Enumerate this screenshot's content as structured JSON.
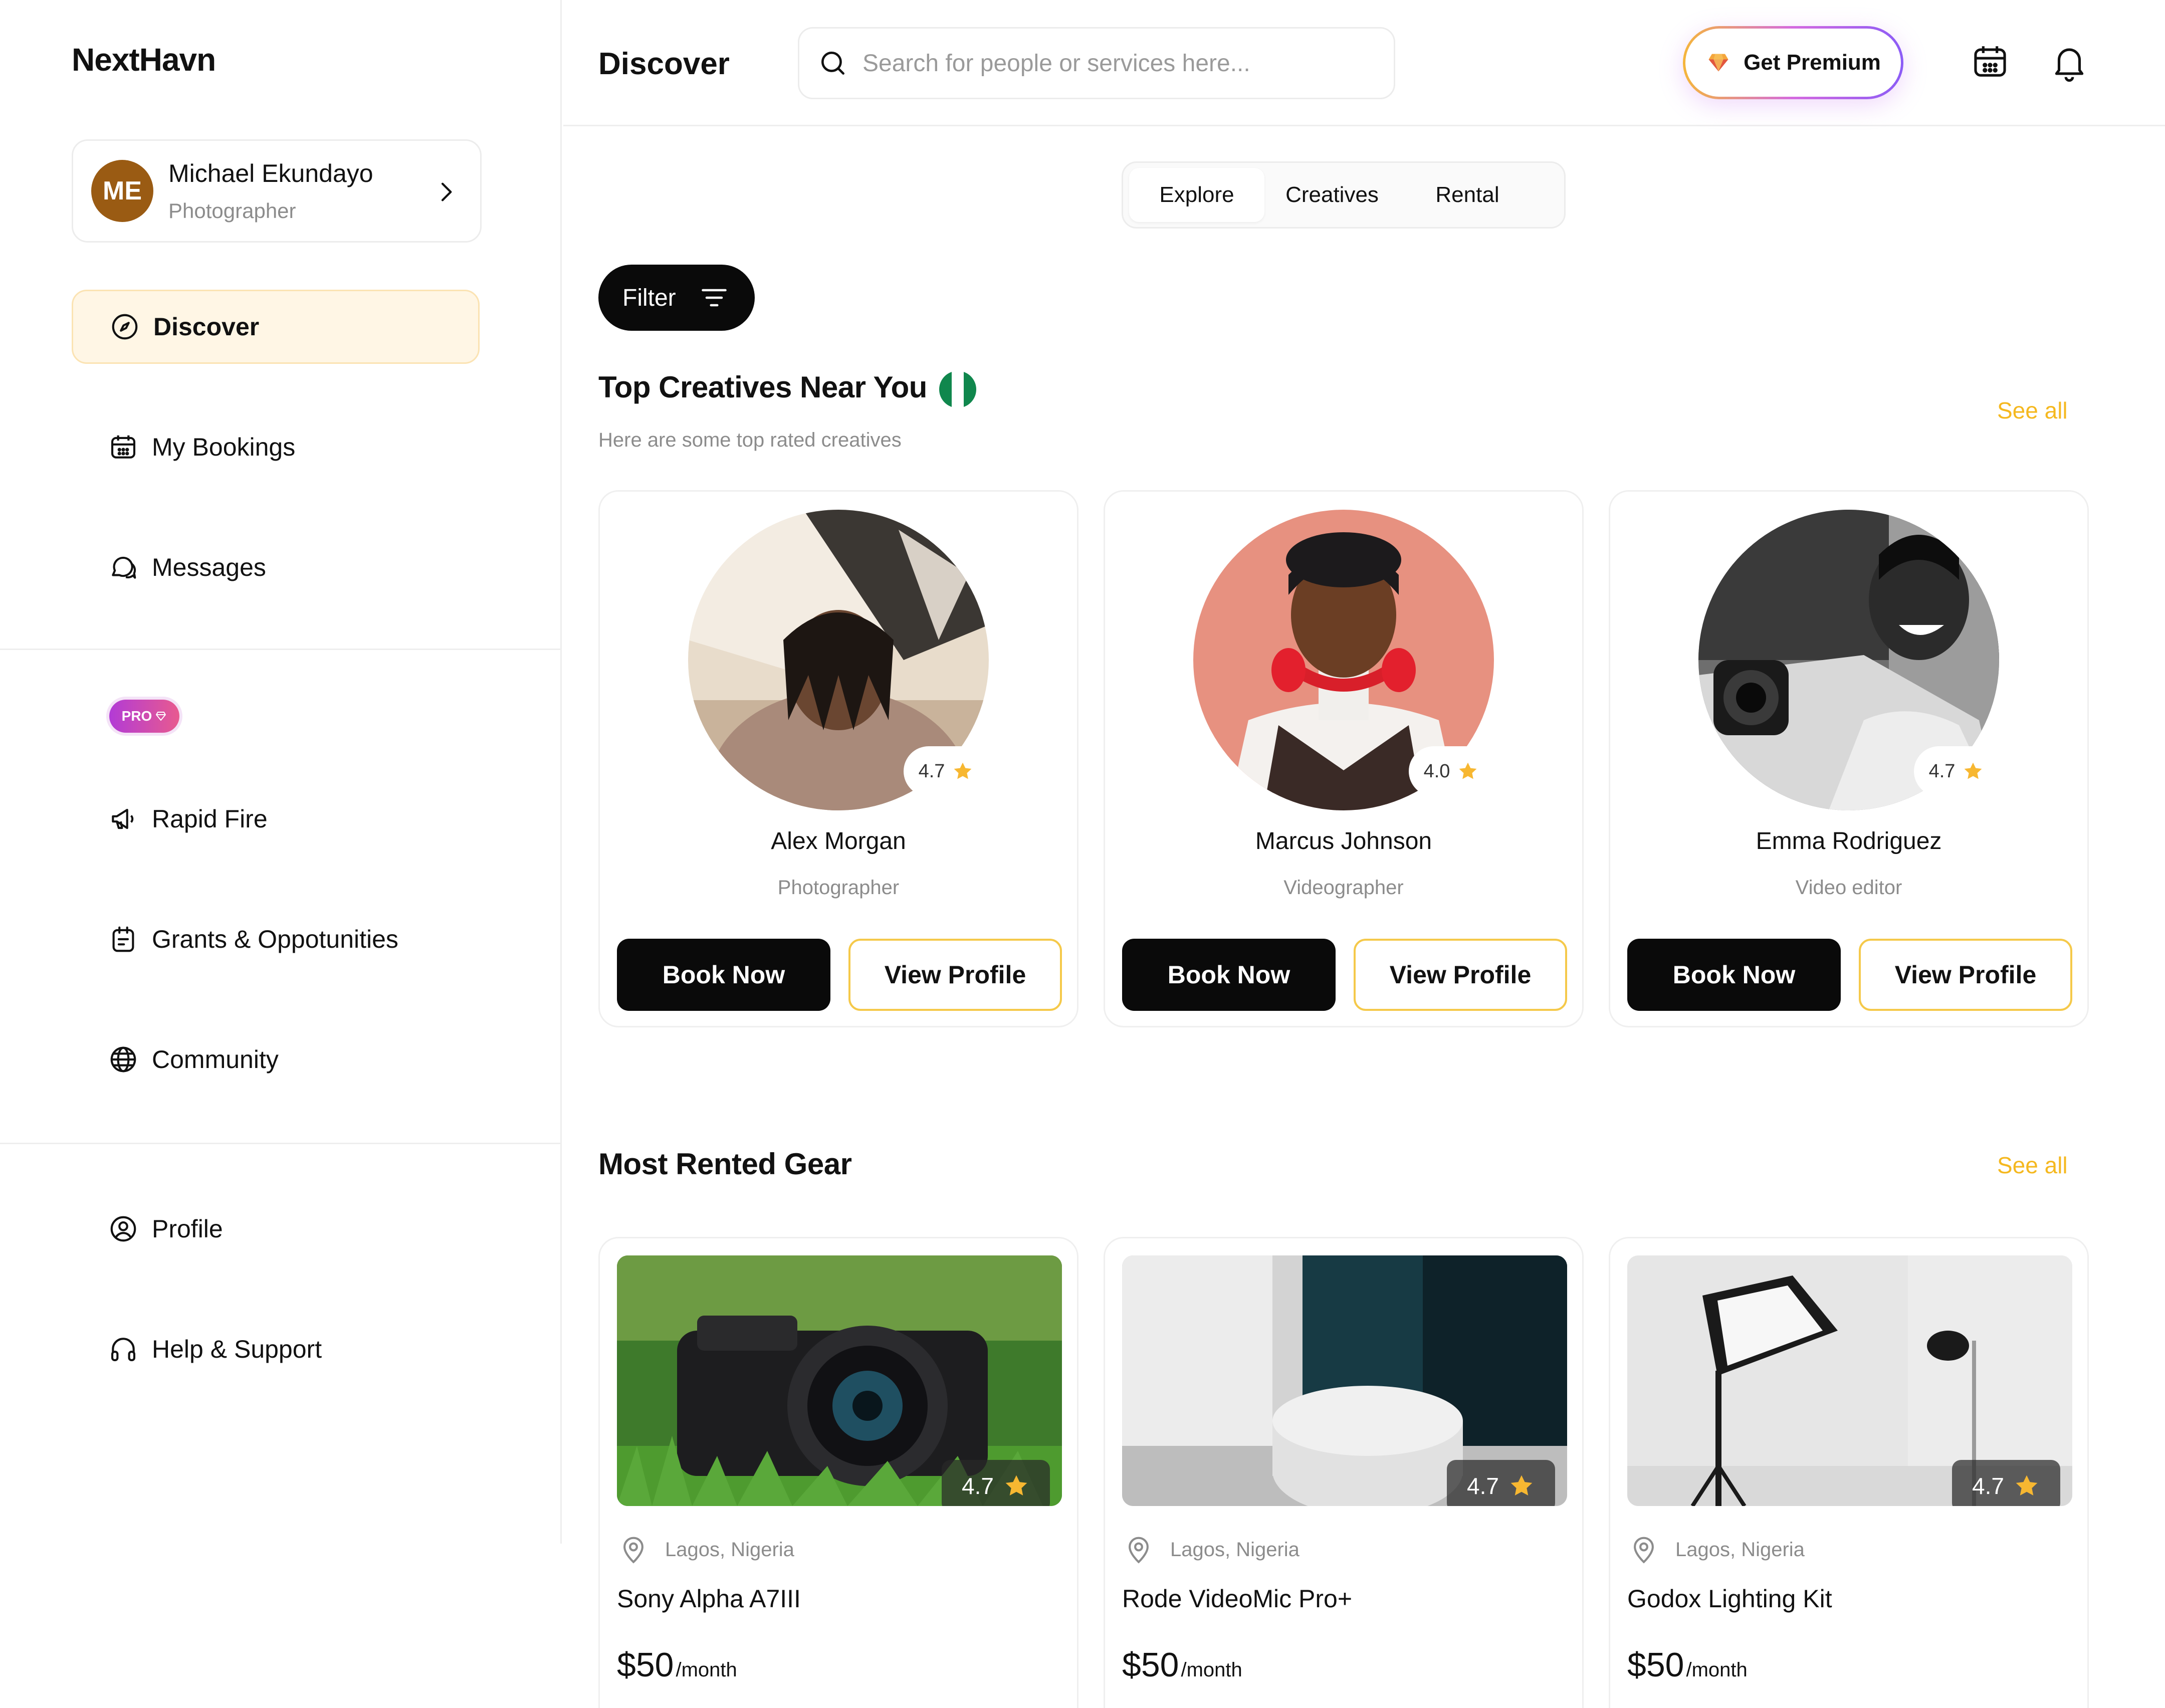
{
  "app": {
    "name": "NextHavn"
  },
  "user": {
    "initials": "ME",
    "name": "Michael Ekundayo",
    "role": "Photographer"
  },
  "sidebar": {
    "items": [
      {
        "label": "Discover"
      },
      {
        "label": "My Bookings"
      },
      {
        "label": "Messages"
      },
      {
        "label": "Rapid Fire"
      },
      {
        "label": "Grants & Oppotunities"
      },
      {
        "label": "Community"
      },
      {
        "label": "Profile"
      },
      {
        "label": "Help & Support"
      }
    ],
    "pro_badge": "PRO"
  },
  "header": {
    "title": "Discover",
    "search_placeholder": "Search for people or services here...",
    "premium_label": "Get Premium"
  },
  "tabs": [
    {
      "label": "Explore",
      "active": true
    },
    {
      "label": "Creatives",
      "active": false
    },
    {
      "label": "Rental",
      "active": false
    }
  ],
  "filter": {
    "label": "Filter"
  },
  "creatives_section": {
    "title": "Top Creatives Near You",
    "subtitle": "Here are some top rated creatives",
    "see_all": "See all",
    "book_label": "Book Now",
    "view_label": "View Profile",
    "cards": [
      {
        "name": "Alex Morgan",
        "role": "Photographer",
        "rating": "4.7"
      },
      {
        "name": "Marcus Johnson",
        "role": "Videographer",
        "rating": "4.0"
      },
      {
        "name": "Emma Rodriguez",
        "role": "Video editor",
        "rating": "4.7"
      }
    ]
  },
  "gear_section": {
    "title": "Most Rented Gear",
    "see_all": "See all",
    "cards": [
      {
        "name": "Sony Alpha A7III",
        "location": "Lagos, Nigeria",
        "price": "$50",
        "unit": "/month",
        "rating": "4.7"
      },
      {
        "name": "Rode VideoMic Pro+",
        "location": "Lagos, Nigeria",
        "price": "$50",
        "unit": "/month",
        "rating": "4.7"
      },
      {
        "name": "Godox Lighting Kit",
        "location": "Lagos, Nigeria",
        "price": "$50",
        "unit": "/month",
        "rating": "4.7"
      }
    ]
  },
  "colors": {
    "accent": "#f5b81f",
    "active_nav_bg": "#fff6e5",
    "avatar_bg": "#9a5b13",
    "button_dark": "#0a0a0a"
  }
}
